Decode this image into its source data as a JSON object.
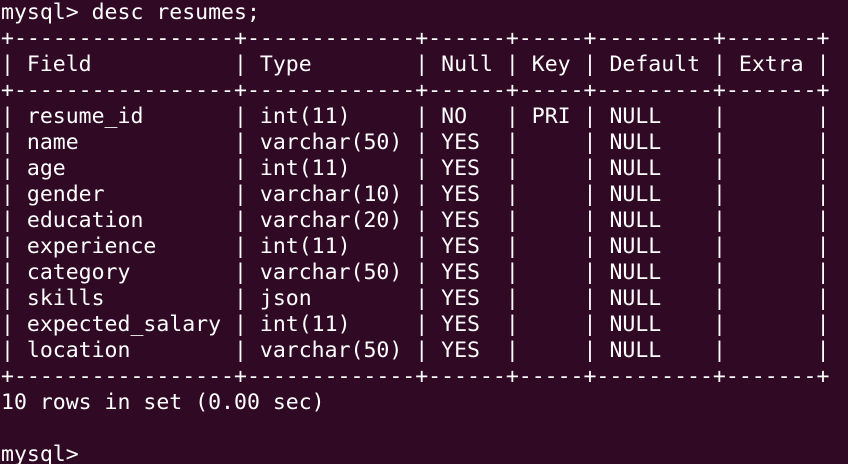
{
  "terminal": {
    "command_line": "mysql> desc resumes;",
    "separator": "+-----------------+-------------+------+-----+---------+-------+",
    "header": {
      "field": "Field",
      "type": "Type",
      "null": "Null",
      "key": "Key",
      "default": "Default",
      "extra": "Extra"
    },
    "rows": [
      {
        "field": "resume_id",
        "type": "int(11)",
        "null": "NO",
        "key": "PRI",
        "default": "NULL",
        "extra": ""
      },
      {
        "field": "name",
        "type": "varchar(50)",
        "null": "YES",
        "key": "",
        "default": "NULL",
        "extra": ""
      },
      {
        "field": "age",
        "type": "int(11)",
        "null": "YES",
        "key": "",
        "default": "NULL",
        "extra": ""
      },
      {
        "field": "gender",
        "type": "varchar(10)",
        "null": "YES",
        "key": "",
        "default": "NULL",
        "extra": ""
      },
      {
        "field": "education",
        "type": "varchar(20)",
        "null": "YES",
        "key": "",
        "default": "NULL",
        "extra": ""
      },
      {
        "field": "experience",
        "type": "int(11)",
        "null": "YES",
        "key": "",
        "default": "NULL",
        "extra": ""
      },
      {
        "field": "category",
        "type": "varchar(50)",
        "null": "YES",
        "key": "",
        "default": "NULL",
        "extra": ""
      },
      {
        "field": "skills",
        "type": "json",
        "null": "YES",
        "key": "",
        "default": "NULL",
        "extra": ""
      },
      {
        "field": "expected_salary",
        "type": "int(11)",
        "null": "YES",
        "key": "",
        "default": "NULL",
        "extra": ""
      },
      {
        "field": "location",
        "type": "varchar(50)",
        "null": "YES",
        "key": "",
        "default": "NULL",
        "extra": ""
      }
    ],
    "result_summary": "10 rows in set (0.00 sec)",
    "prompt": "mysql> ",
    "colors": {
      "background": "#300a24",
      "text": "#ffffff"
    }
  }
}
